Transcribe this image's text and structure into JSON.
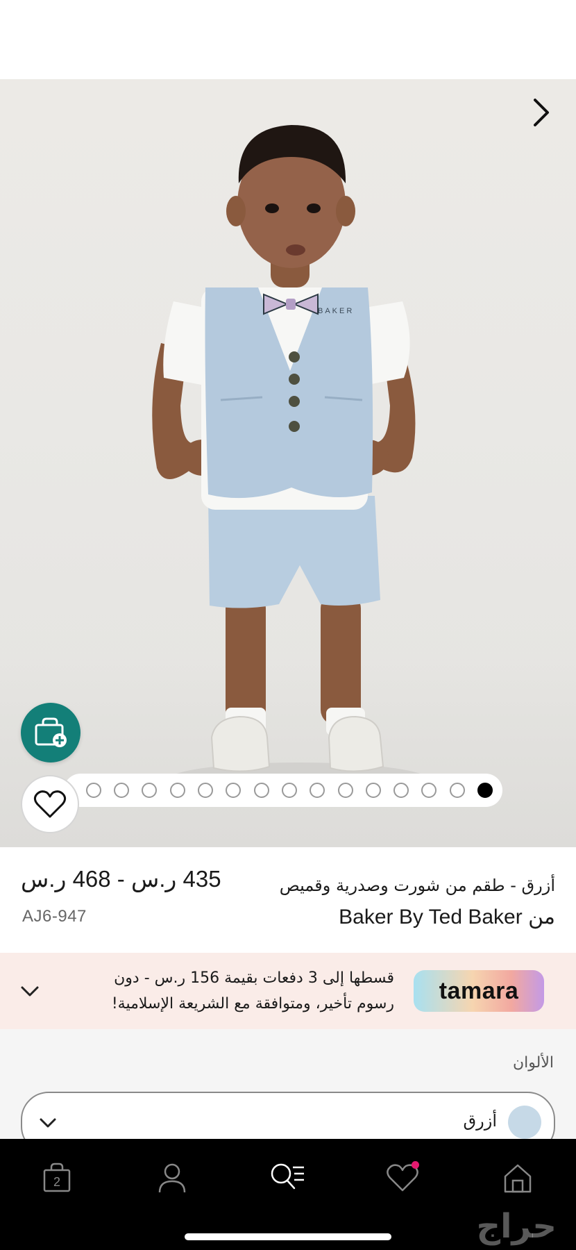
{
  "product": {
    "title_line1": "أزرق - طقم من شورت وصدرية وقميص",
    "title_line2": "من Baker By Ted Baker",
    "price_range": "435 ر.س - 468 ر.س",
    "sku": "AJ6-947",
    "vest_logo_text": "BAKER"
  },
  "gallery": {
    "image_count": 15,
    "active_index": 14
  },
  "tamara": {
    "logo_text": "tamara",
    "message_line1": "قسطها إلى 3 دفعات بقيمة 156 ر.س - دون",
    "message_line2": "رسوم تأخير، ومتوافقة مع الشريعة الإسلامية!"
  },
  "colors": {
    "label": "الألوان",
    "selected": "أزرق",
    "swatch_color": "#c6d9e7"
  },
  "bottom_nav": {
    "bag_count": "2",
    "has_wishlist_notification": true,
    "accent_color": "#e4196f"
  },
  "watermark": "حراج",
  "theme": {
    "bag_button_color": "#137f78"
  }
}
